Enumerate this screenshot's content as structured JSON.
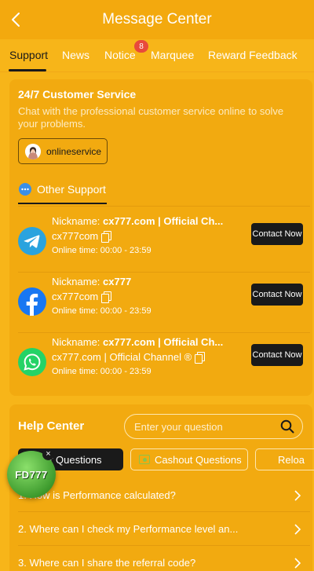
{
  "header": {
    "title": "Message Center"
  },
  "tabs": [
    {
      "label": "Support"
    },
    {
      "label": "News"
    },
    {
      "label": "Notice",
      "badge": "8"
    },
    {
      "label": "Marquee"
    },
    {
      "label": "Reward Feedback"
    }
  ],
  "customer_service": {
    "title": "24/7 Customer Service",
    "description": "Chat with the professional customer service online to solve your problems.",
    "online_button": "onlineservice"
  },
  "other_support": {
    "label": "Other Support",
    "items": [
      {
        "icon": "telegram-icon",
        "nick_label": "Nickname: ",
        "nick_value": "cx777.com | Official Ch...",
        "handle": "cx777com",
        "time": "Online time: 00:00 - 23:59",
        "contact_label": "Contact Now"
      },
      {
        "icon": "facebook-icon",
        "nick_label": "Nickname: ",
        "nick_value": "cx777",
        "handle": "cx777com",
        "time": "Online time: 00:00 - 23:59",
        "contact_label": "Contact Now"
      },
      {
        "icon": "whatsapp-icon",
        "nick_label": "Nickname: ",
        "nick_value": "cx777.com | Official Ch...",
        "handle": "cx777.com | Official Channel ®",
        "time": "Online time: 00:00 - 23:59",
        "contact_label": "Contact Now"
      }
    ]
  },
  "help_center": {
    "title": "Help Center",
    "search_placeholder": "Enter your question",
    "chips": [
      {
        "label": "ther Questions"
      },
      {
        "label": "Cashout Questions"
      },
      {
        "label": "Reloa"
      }
    ],
    "faqs": [
      {
        "q": "1. How is Performance calculated?"
      },
      {
        "q": "2. Where can I check my Performance level an..."
      },
      {
        "q": "3. Where can I share the referral code?"
      }
    ]
  },
  "floating": {
    "label": "FD777",
    "close": "×"
  },
  "colors": {
    "accent": "#F7B519",
    "card": "#F2AA10",
    "dark": "#1a1a1a",
    "badge": "#E84A3C"
  }
}
